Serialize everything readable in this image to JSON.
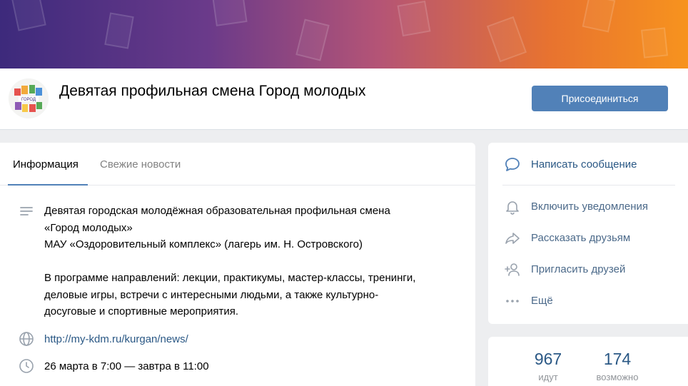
{
  "group": {
    "title": "Девятая профильная смена Город молодых",
    "join_label": "Присоединиться"
  },
  "tabs": [
    {
      "label": "Информация",
      "active": true
    },
    {
      "label": "Свежие новости",
      "active": false
    }
  ],
  "info": {
    "description": "Девятая городская молодёжная образовательная профильная смена\n«Город молодых»\nМАУ «Оздоровительный комплекс» (лагерь им. Н. Островского)\n\nВ программе направлений: лекции, практикумы, мастер-классы, тренинги,\nделовые игры, встречи с интересными людьми, а также культурно-\nдосуговые и спортивные мероприятия.",
    "website": "http://my-kdm.ru/kurgan/news/",
    "datetime": "26 марта в 7:00 — завтра в 11:00"
  },
  "actions": {
    "message": "Написать сообщение",
    "notifications": "Включить уведомления",
    "share": "Рассказать друзьям",
    "invite": "Пригласить друзей",
    "more": "Ещё"
  },
  "stats": [
    {
      "value": "967",
      "label": "идут"
    },
    {
      "value": "174",
      "label": "возможно"
    }
  ],
  "icons": {
    "description": "list-icon",
    "website": "globe-icon",
    "datetime": "clock-icon",
    "message": "message-bubble-icon",
    "notifications": "bell-icon",
    "share": "share-arrow-icon",
    "invite": "add-user-icon",
    "more": "more-dots-icon"
  },
  "colors": {
    "accent": "#5181b8",
    "link": "#2a5885",
    "cover_start": "#3d2a7c",
    "cover_end": "#f7931e"
  }
}
